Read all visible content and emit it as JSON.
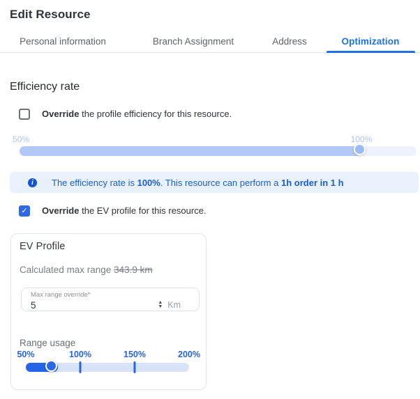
{
  "window": {
    "title": "Edit Resource"
  },
  "tabs": [
    {
      "label": "Personal information",
      "active": false
    },
    {
      "label": "Branch Assignment",
      "active": false
    },
    {
      "label": "Address",
      "active": false
    },
    {
      "label": "Optimization",
      "active": true
    }
  ],
  "efficiency": {
    "heading": "Efficiency rate",
    "override_checkbox": {
      "checked": false,
      "label_bold": "Override",
      "label_rest": " the profile efficiency for this resource."
    },
    "slider": {
      "min_label": "50%",
      "value_label": "100%",
      "value_percent": 100
    },
    "info_banner": {
      "text_1": "The efficiency rate is ",
      "bold_1": "100%",
      "text_2": ". This resource can perform a ",
      "bold_2": "1h order in 1 h"
    },
    "ev_checkbox": {
      "checked": true,
      "label_bold": "Override",
      "label_rest": " the EV profile for this resource."
    }
  },
  "ev_profile": {
    "title": "EV Profile",
    "calculated_max_range_label": "Calculated max range ",
    "calculated_max_range_value": "343.9 km",
    "max_range_input": {
      "label": "Max range override*",
      "value": "5",
      "unit": "Km"
    },
    "range_usage": {
      "label": "Range usage",
      "tick_labels": [
        "50%",
        "100%",
        "150%",
        "200%"
      ],
      "handle_value_percent": 75
    }
  },
  "icons": {
    "info": "i",
    "check": "✓",
    "stepper_up": "▲",
    "stepper_down": "▼"
  },
  "colors": {
    "accent_blue": "#1a73e8",
    "bright_blue": "#2563eb",
    "light_slider_fill": "#b1c8f8",
    "light_slider_track": "#eef2fc",
    "light_slider_handle": "#9cbaf4",
    "range_track": "#d8e3f7",
    "banner_bg": "#e9f1fd",
    "banner_text": "#1a5ed6",
    "checkbox_checked": "#2e6ae8",
    "text_dark": "#2f3439",
    "text_gray": "#5f6368",
    "muted_gray": "#797e84",
    "border_gray": "#e3e5ea"
  }
}
